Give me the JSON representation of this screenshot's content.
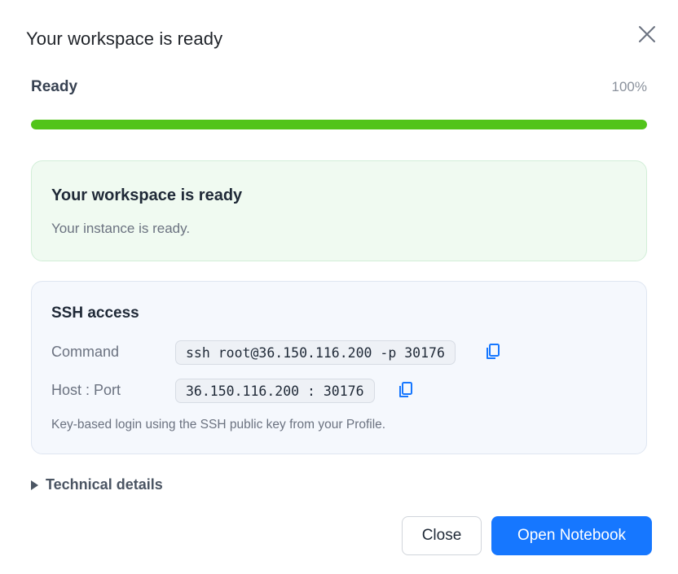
{
  "modal": {
    "title": "Your workspace is ready"
  },
  "progress": {
    "label": "Ready",
    "percent_text": "100%",
    "value": 100,
    "color": "#52c41a"
  },
  "success_card": {
    "title": "Your workspace is ready",
    "subtitle": "Your instance is ready."
  },
  "ssh": {
    "title": "SSH access",
    "command_label": "Command",
    "command_value": "ssh root@36.150.116.200 -p 30176",
    "hostport_label": "Host : Port",
    "hostport_value": "36.150.116.200 : 30176",
    "note": "Key-based login using the SSH public key from your Profile.",
    "copy_icon": "copy-icon"
  },
  "technical_details": {
    "label": "Technical details",
    "icon": "caret-right-icon"
  },
  "footer": {
    "close_label": "Close",
    "open_label": "Open Notebook"
  },
  "colors": {
    "primary": "#1677ff",
    "success_bg": "#f0faf1",
    "ssh_bg": "#f5f8fd"
  }
}
